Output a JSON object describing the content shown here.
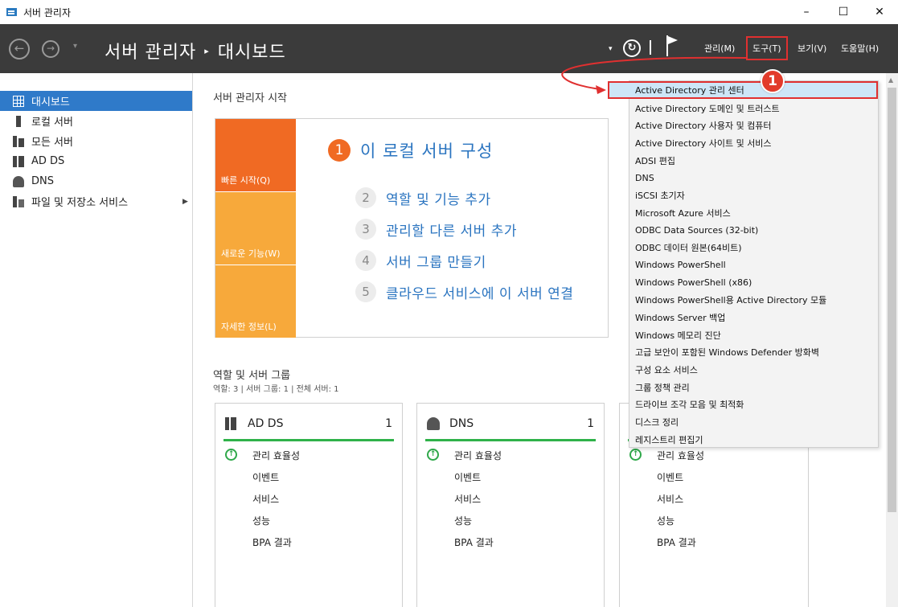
{
  "window": {
    "title": "서버 관리자",
    "minimize": "–",
    "maximize": "☐",
    "close": "✕"
  },
  "header": {
    "back": "←",
    "forward": "→",
    "nav_dropdown": "▾",
    "app": "서버 관리자",
    "separator": "▸",
    "page": "대시보드",
    "refresh": "↻",
    "dropdown": "▾",
    "menus": [
      "관리(M)",
      "도구(T)",
      "보기(V)",
      "도움말(H)"
    ]
  },
  "sidebar": {
    "items": [
      {
        "label": "대시보드",
        "icon": "dashboard-grid-icon",
        "selected": true
      },
      {
        "label": "로컬 서버",
        "icon": "server-icon"
      },
      {
        "label": "모든 서버",
        "icon": "servers-icon"
      },
      {
        "label": "AD DS",
        "icon": "ad-ds-icon"
      },
      {
        "label": "DNS",
        "icon": "dns-icon"
      },
      {
        "label": "파일 및 저장소 서비스",
        "icon": "file-storage-icon",
        "chevron": "▶"
      }
    ]
  },
  "main": {
    "welcome_title": "서버 관리자 시작",
    "tiles": [
      "빠른 시작(Q)",
      "새로운 기능(W)",
      "자세한 정보(L)"
    ],
    "steps": [
      {
        "num": "1",
        "text": "이 로컬 서버 구성"
      },
      {
        "num": "2",
        "text": "역할 및 기능 추가"
      },
      {
        "num": "3",
        "text": "관리할 다른 서버 추가"
      },
      {
        "num": "4",
        "text": "서버 그룹 만들기"
      },
      {
        "num": "5",
        "text": "클라우드 서비스에 이 서버 연결"
      }
    ],
    "roles_title": "역할 및 서버 그룹",
    "roles_subtitle": "역할: 3   |   서버 그룹: 1   |   전체 서버: 1",
    "cards": [
      {
        "name": "AD DS",
        "count": "1",
        "rows": [
          "관리 효율성",
          "이벤트",
          "서비스",
          "성능",
          "BPA 결과"
        ]
      },
      {
        "name": "DNS",
        "count": "1",
        "rows": [
          "관리 효율성",
          "이벤트",
          "서비스",
          "성능",
          "BPA 결과"
        ]
      },
      {
        "name": "",
        "count": "",
        "rows": [
          "관리 효율성",
          "이벤트",
          "서비스",
          "성능",
          "BPA 결과"
        ]
      }
    ]
  },
  "tools_menu": {
    "items": [
      "Active Directory 관리 센터",
      "Active Directory 도메인 및 트러스트",
      "Active Directory 사용자 및 컴퓨터",
      "Active Directory 사이트 및 서비스",
      "ADSI 편집",
      "DNS",
      "iSCSI 초기자",
      "Microsoft Azure 서비스",
      "ODBC Data Sources (32-bit)",
      "ODBC 데이터 원본(64비트)",
      "Windows PowerShell",
      "Windows PowerShell (x86)",
      "Windows PowerShell용 Active Directory 모듈",
      "Windows Server 백업",
      "Windows 메모리 진단",
      "고급 보안이 포함된 Windows Defender 방화벽",
      "구성 요소 서비스",
      "그룹 정책 관리",
      "드라이브 조각 모음 및 최적화",
      "디스크 정리",
      "레지스트리 편집기"
    ]
  },
  "callout": {
    "number": "1"
  },
  "colors": {
    "header_bg": "#3b3b3b",
    "accent_blue": "#2f7ac9",
    "orange": "#f06a23",
    "amber": "#f7a93b",
    "highlight_red": "#e03030",
    "ok_green": "#2fb24a"
  }
}
